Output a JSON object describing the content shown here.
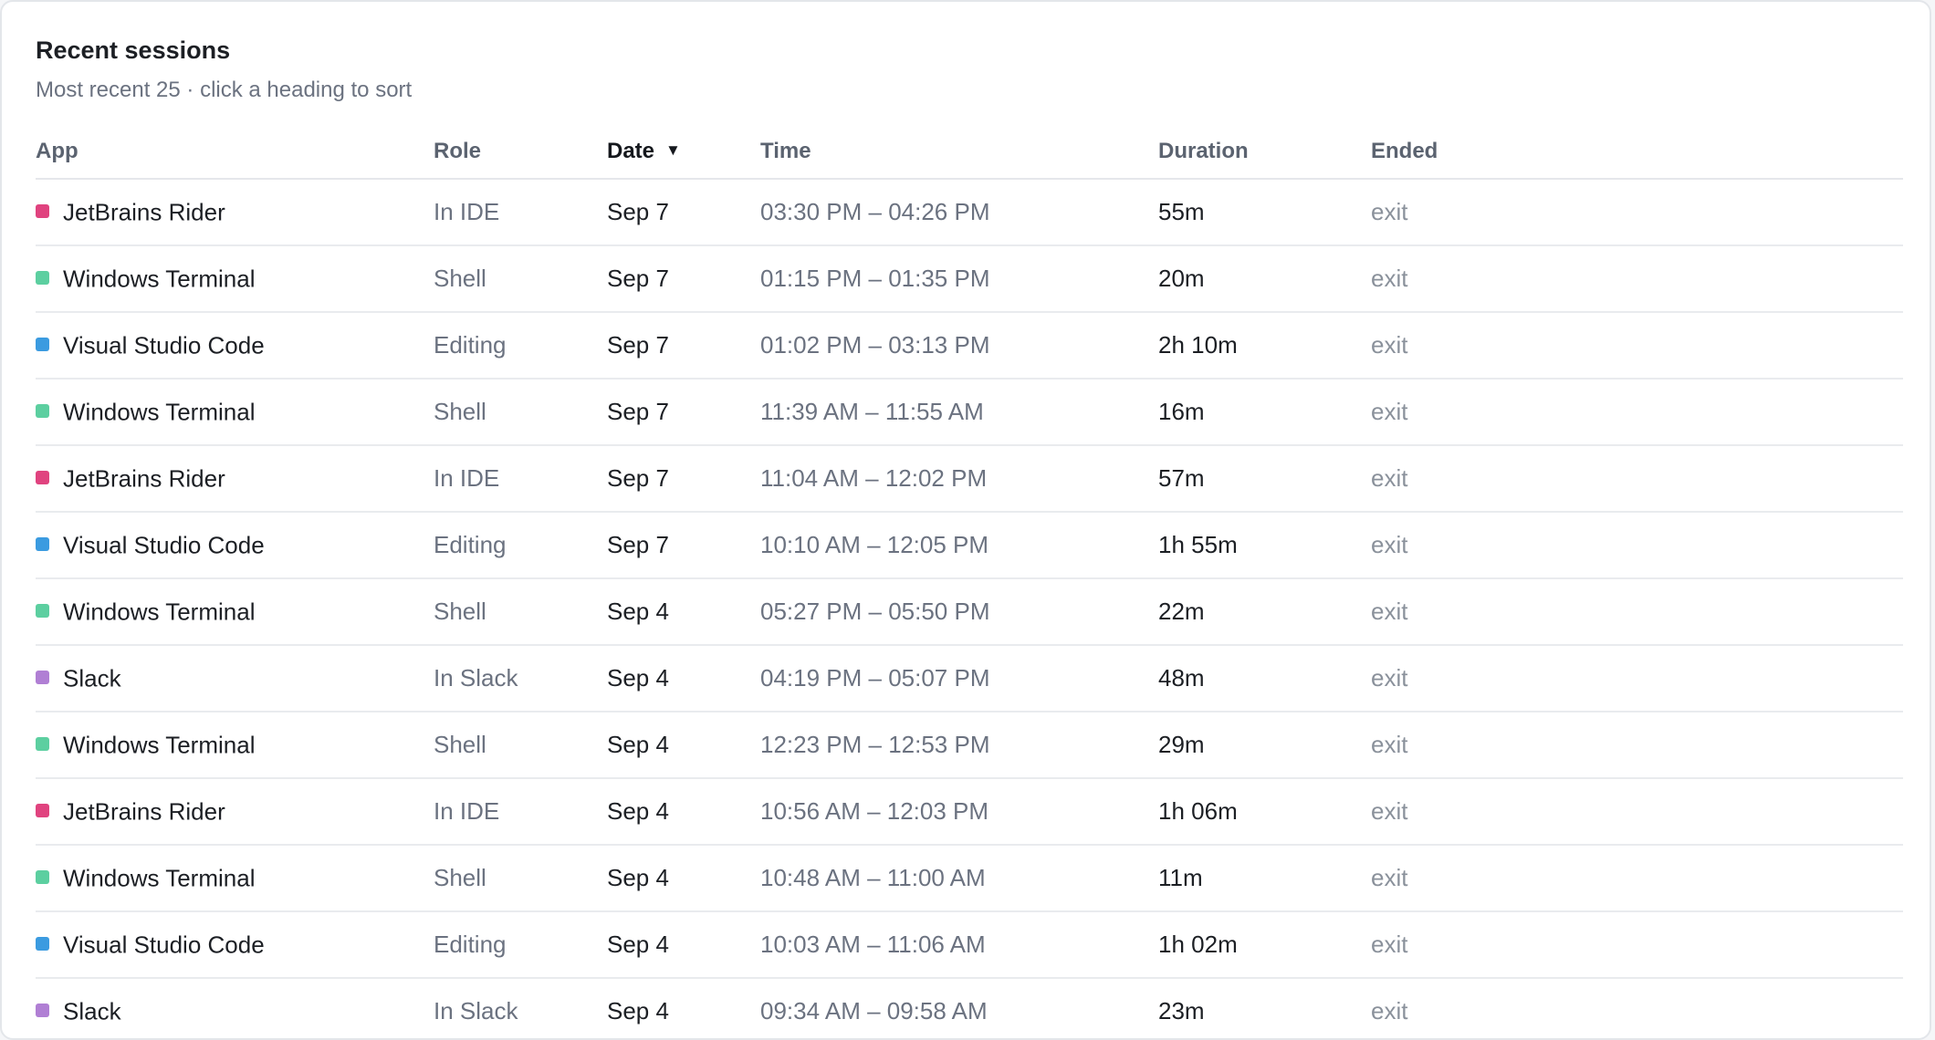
{
  "card": {
    "title": "Recent sessions",
    "subtitle": "Most recent 25 · click a heading to sort"
  },
  "table": {
    "columns": [
      {
        "key": "app",
        "label": "App",
        "sorted": false
      },
      {
        "key": "role",
        "label": "Role",
        "sorted": false
      },
      {
        "key": "date",
        "label": "Date",
        "sorted": true,
        "sort_indicator": "▼"
      },
      {
        "key": "time",
        "label": "Time",
        "sorted": false
      },
      {
        "key": "duration",
        "label": "Duration",
        "sorted": false
      },
      {
        "key": "ended",
        "label": "Ended",
        "sorted": false
      }
    ],
    "rows": [
      {
        "app": "JetBrains Rider",
        "color": "#e0437f",
        "role": "In IDE",
        "date": "Sep 7",
        "time": "03:30 PM – 04:26 PM",
        "duration": "55m",
        "ended": "exit"
      },
      {
        "app": "Windows Terminal",
        "color": "#5ccfa0",
        "role": "Shell",
        "date": "Sep 7",
        "time": "01:15 PM – 01:35 PM",
        "duration": "20m",
        "ended": "exit"
      },
      {
        "app": "Visual Studio Code",
        "color": "#3b9be0",
        "role": "Editing",
        "date": "Sep 7",
        "time": "01:02 PM – 03:13 PM",
        "duration": "2h 10m",
        "ended": "exit"
      },
      {
        "app": "Windows Terminal",
        "color": "#5ccfa0",
        "role": "Shell",
        "date": "Sep 7",
        "time": "11:39 AM – 11:55 AM",
        "duration": "16m",
        "ended": "exit"
      },
      {
        "app": "JetBrains Rider",
        "color": "#e0437f",
        "role": "In IDE",
        "date": "Sep 7",
        "time": "11:04 AM – 12:02 PM",
        "duration": "57m",
        "ended": "exit"
      },
      {
        "app": "Visual Studio Code",
        "color": "#3b9be0",
        "role": "Editing",
        "date": "Sep 7",
        "time": "10:10 AM – 12:05 PM",
        "duration": "1h 55m",
        "ended": "exit"
      },
      {
        "app": "Windows Terminal",
        "color": "#5ccfa0",
        "role": "Shell",
        "date": "Sep 4",
        "time": "05:27 PM – 05:50 PM",
        "duration": "22m",
        "ended": "exit"
      },
      {
        "app": "Slack",
        "color": "#b07fd4",
        "role": "In Slack",
        "date": "Sep 4",
        "time": "04:19 PM – 05:07 PM",
        "duration": "48m",
        "ended": "exit"
      },
      {
        "app": "Windows Terminal",
        "color": "#5ccfa0",
        "role": "Shell",
        "date": "Sep 4",
        "time": "12:23 PM – 12:53 PM",
        "duration": "29m",
        "ended": "exit"
      },
      {
        "app": "JetBrains Rider",
        "color": "#e0437f",
        "role": "In IDE",
        "date": "Sep 4",
        "time": "10:56 AM – 12:03 PM",
        "duration": "1h 06m",
        "ended": "exit"
      },
      {
        "app": "Windows Terminal",
        "color": "#5ccfa0",
        "role": "Shell",
        "date": "Sep 4",
        "time": "10:48 AM – 11:00 AM",
        "duration": "11m",
        "ended": "exit"
      },
      {
        "app": "Visual Studio Code",
        "color": "#3b9be0",
        "role": "Editing",
        "date": "Sep 4",
        "time": "10:03 AM – 11:06 AM",
        "duration": "1h 02m",
        "ended": "exit"
      },
      {
        "app": "Slack",
        "color": "#b07fd4",
        "role": "In Slack",
        "date": "Sep 4",
        "time": "09:34 AM – 09:58 AM",
        "duration": "23m",
        "ended": "exit"
      }
    ]
  }
}
